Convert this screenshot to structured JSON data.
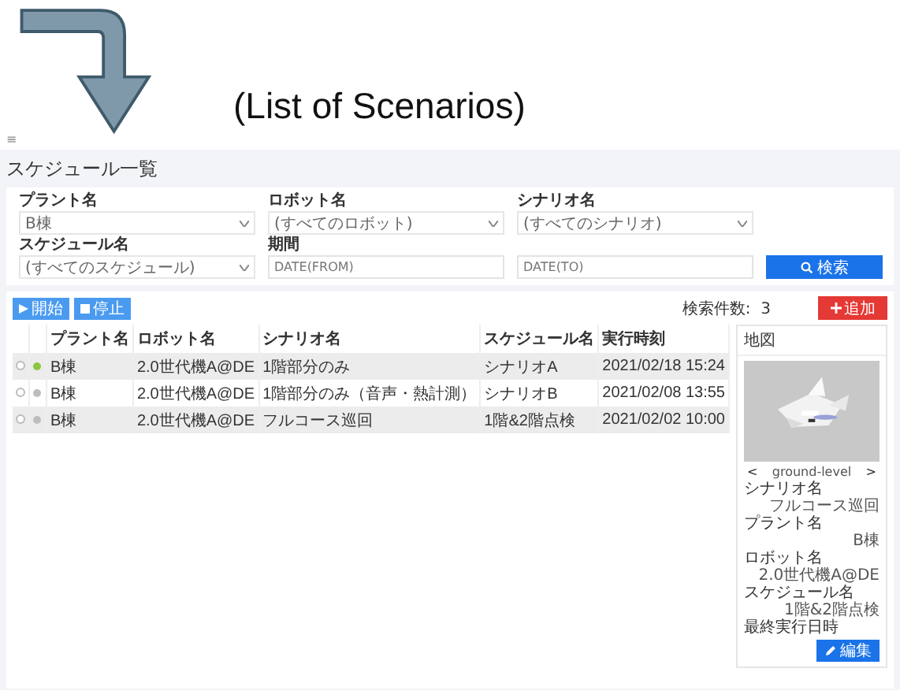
{
  "annotation": {
    "caption": "(List of Scenarios)"
  },
  "menu_glyph": "≡",
  "page_title": "スケジュール一覧",
  "filters": [
    {
      "label": "プラント名",
      "kind": "select",
      "value": "B棟"
    },
    {
      "label": "ロボット名",
      "kind": "select",
      "value": "(すべてのロボット)"
    },
    {
      "label": "シナリオ名",
      "kind": "select",
      "value": "(すべてのシナリオ)"
    },
    {
      "label": "スケジュール名",
      "kind": "select",
      "value": "(すべてのスケジュール)"
    },
    {
      "label": "期間",
      "kind": "date",
      "placeholder": "DATE(FROM)"
    },
    {
      "kind": "date",
      "placeholder": "DATE(TO)"
    }
  ],
  "search_button": "検索",
  "actions": [
    {
      "label": "開始",
      "kind": "start"
    },
    {
      "label": "停止",
      "kind": "stop"
    }
  ],
  "result_count": {
    "label": "検索件数:",
    "value": "3"
  },
  "add_button": "追加",
  "table": {
    "columns": [
      "プラント名",
      "ロボット名",
      "シナリオ名",
      "スケジュール名",
      "実行時刻"
    ],
    "rows": [
      {
        "selected": false,
        "color": "#8cc63f",
        "cells": [
          "B棟",
          "2.0世代機A@DE",
          "1階部分のみ",
          "シナリオA",
          "2021/02/18 15:24"
        ]
      },
      {
        "selected": false,
        "color": "#bdbdbd",
        "cells": [
          "B棟",
          "2.0世代機A@DE",
          "1階部分のみ（音声・熱計測）",
          "シナリオB",
          "2021/02/08 13:55"
        ]
      },
      {
        "selected": false,
        "color": "#bdbdbd",
        "cells": [
          "B棟",
          "2.0世代機A@DE",
          "フルコース巡回",
          "1階&2階点検",
          "2021/02/02 10:00"
        ]
      }
    ]
  },
  "map_panel": {
    "title": "地図",
    "level": "ground-level",
    "prev": "<",
    "next": ">",
    "details": [
      {
        "key": "シナリオ名",
        "value": "フルコース巡回"
      },
      {
        "key": "プラント名",
        "value": "B棟"
      },
      {
        "key": "ロボット名",
        "value": "2.0世代機A@DE"
      },
      {
        "key": "スケジュール名",
        "value": "1階&2階点検"
      },
      {
        "key": "最終実行日時"
      }
    ],
    "edit_button": "編集"
  }
}
